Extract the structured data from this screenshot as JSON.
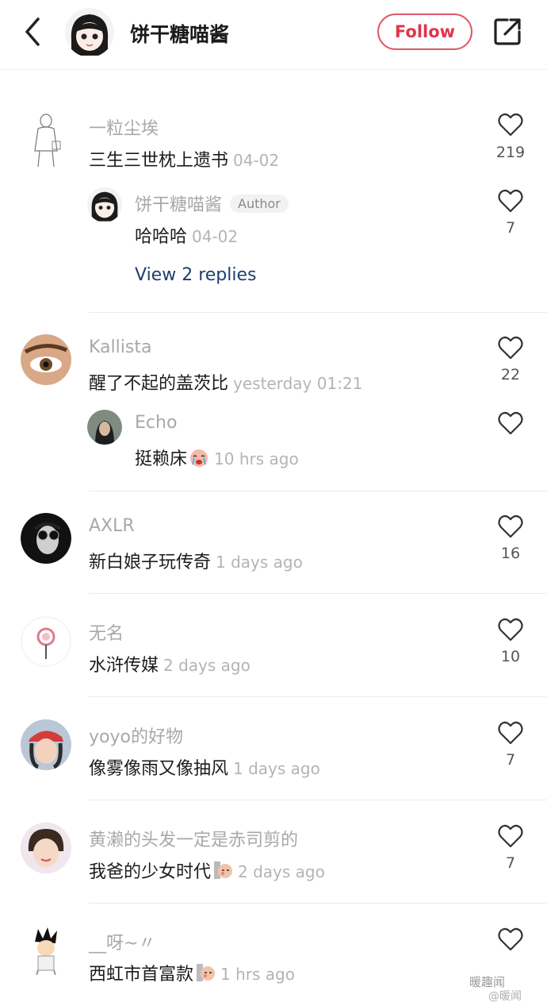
{
  "header": {
    "title": "饼干糖喵酱",
    "follow_label": "Follow"
  },
  "view_replies": "View 2 replies",
  "author_badge": "Author",
  "comments": [
    {
      "user": "一粒尘埃",
      "text": "三生三世枕上遗书",
      "time": "04-02",
      "likes": "219"
    },
    {
      "user": "饼干糖喵酱",
      "text": "哈哈哈",
      "time": "04-02",
      "likes": "7"
    },
    {
      "user": "Kallista",
      "text": "醒了不起的盖茨比",
      "time": "yesterday 01:21",
      "likes": "22"
    },
    {
      "user": "Echo",
      "text": "挺赖床",
      "time": "10 hrs ago",
      "likes": ""
    },
    {
      "user": "AXLR",
      "text": "新白娘子玩传奇",
      "time": "1 days ago",
      "likes": "16"
    },
    {
      "user": "无名",
      "text": "水浒传媒",
      "time": "2 days ago",
      "likes": "10"
    },
    {
      "user": "yoyo的好物",
      "text": "像雾像雨又像抽风",
      "time": "1 days ago",
      "likes": "7"
    },
    {
      "user": "黄濑的头发一定是赤司剪的",
      "text": "我爸的少女时代",
      "time": "2 days ago",
      "likes": "7"
    },
    {
      "user": "__呀~〃",
      "text": "西虹市首富款",
      "time": "1 hrs ago",
      "likes": ""
    }
  ],
  "watermark": {
    "line1": "暖趣闻",
    "line2": "@暖闻"
  },
  "colors": {
    "follow_red": "#e0354b",
    "link_blue": "#1d3f6e",
    "username_grey": "#a8a8a8"
  },
  "icons": [
    "back-arrow-icon",
    "share-icon",
    "heart-icon"
  ]
}
